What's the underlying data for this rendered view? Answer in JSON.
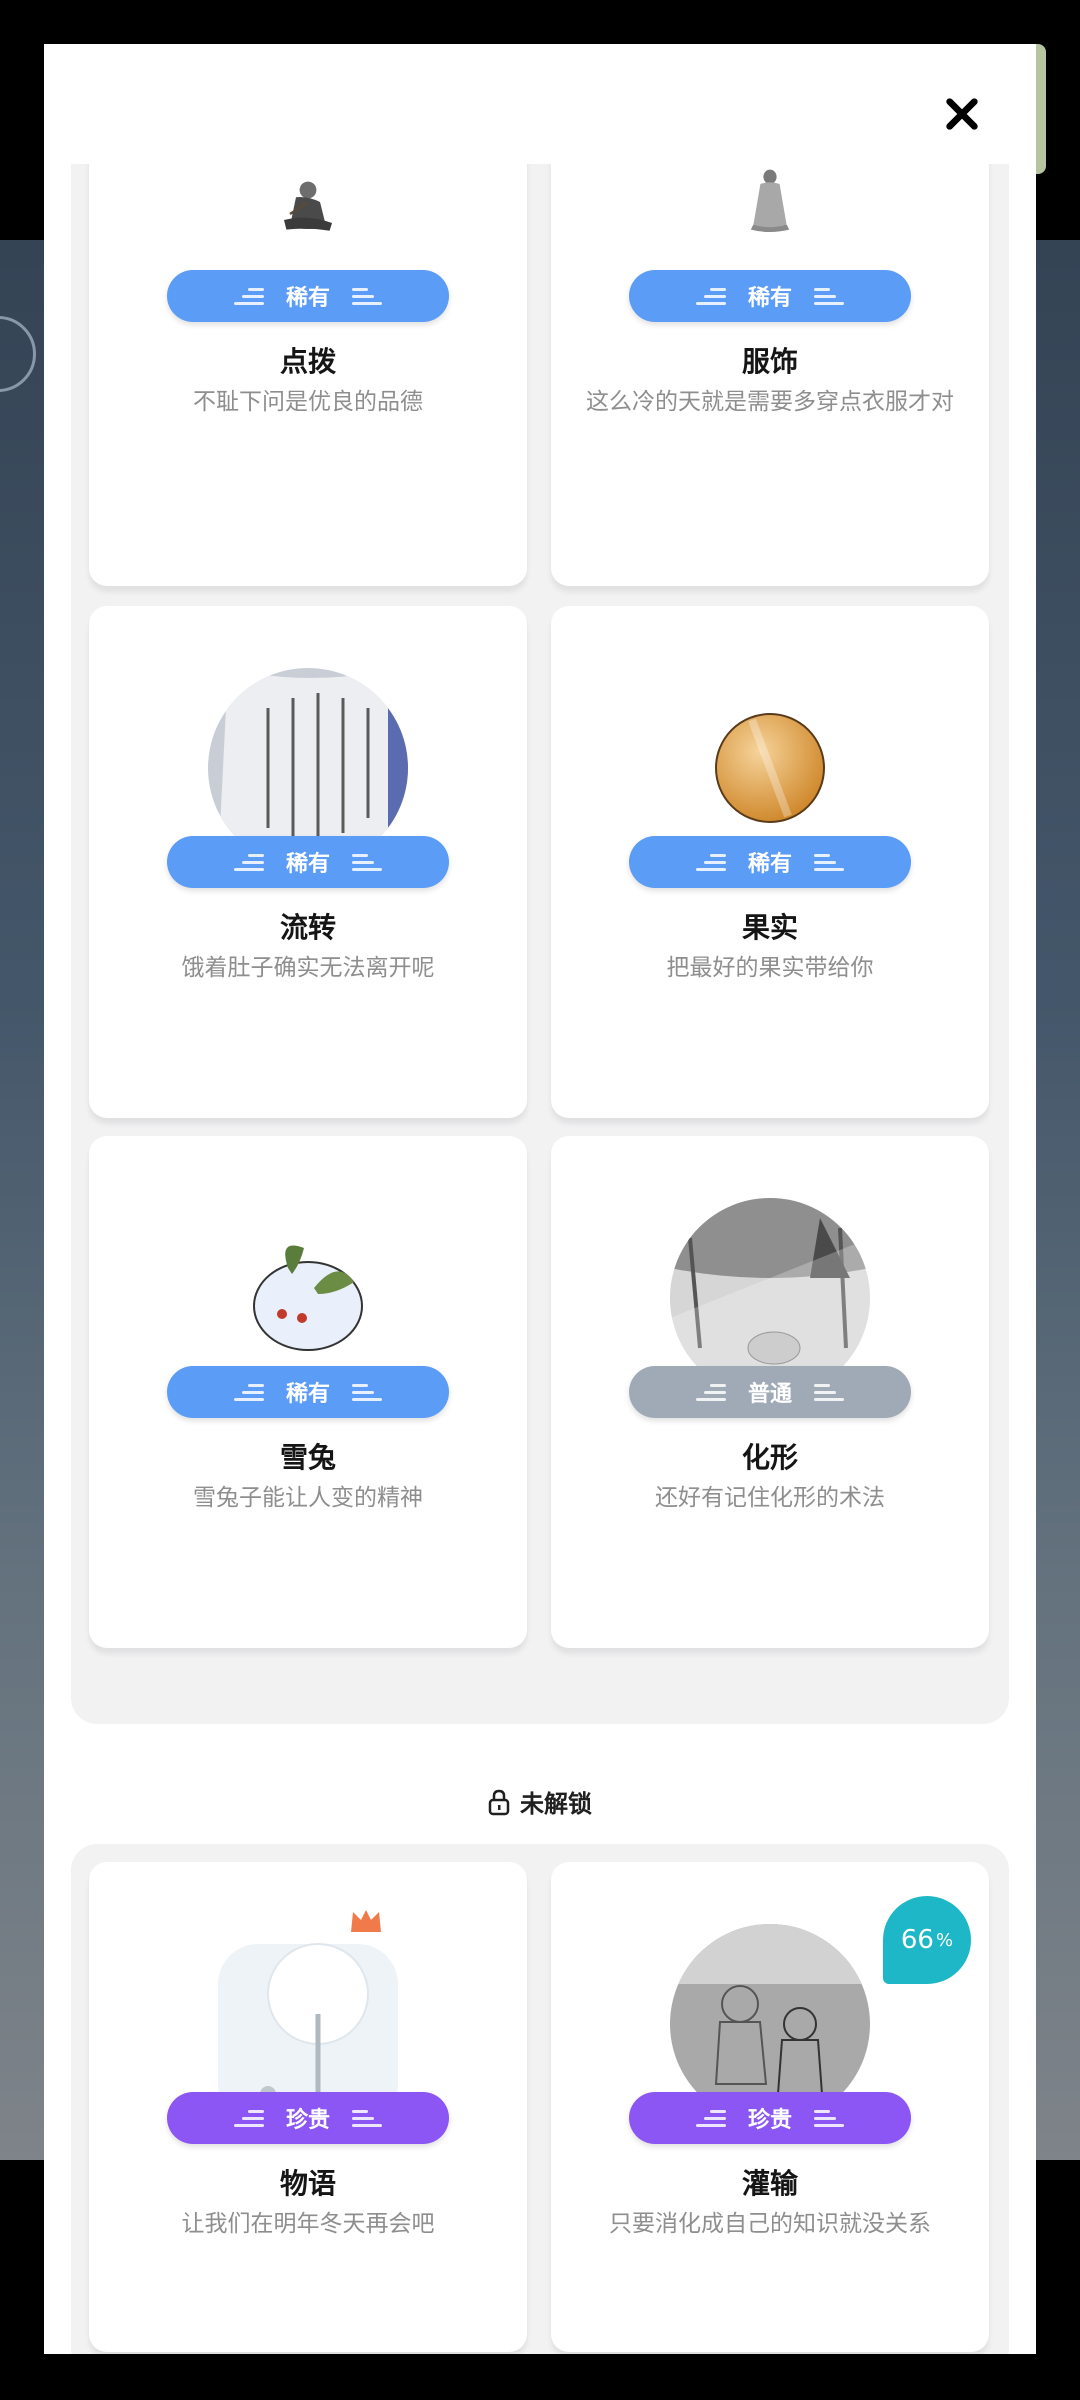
{
  "close_label": "×",
  "locked_section": {
    "label": "未解锁"
  },
  "unlocked_cards": [
    {
      "title": "点拨",
      "desc": "不耻下问是优良的品德",
      "rarity": "稀有",
      "rarity_type": "rare",
      "art": "seated-sage-figure"
    },
    {
      "title": "服饰",
      "desc": "这么冷的天就是需要多穿点衣服才对",
      "rarity": "稀有",
      "rarity_type": "rare",
      "art": "robed-figure-back"
    },
    {
      "title": "流转",
      "desc": "饿着肚子确实无法离开呢",
      "rarity": "稀有",
      "rarity_type": "rare",
      "art": "calligraphy-scroll"
    },
    {
      "title": "果实",
      "desc": "把最好的果实带给你",
      "rarity": "稀有",
      "rarity_type": "rare",
      "art": "orange-fruit"
    },
    {
      "title": "雪兔",
      "desc": "雪兔子能让人变的精神",
      "rarity": "稀有",
      "rarity_type": "rare",
      "art": "snow-rabbit"
    },
    {
      "title": "化形",
      "desc": "还好有记住化形的术法",
      "rarity": "普通",
      "rarity_type": "common",
      "art": "misty-forest-elephant"
    }
  ],
  "locked_cards": [
    {
      "title": "物语",
      "desc": "让我们在明年冬天再会吧",
      "rarity": "珍贵",
      "rarity_type": "precious",
      "art": "snowy-tree"
    },
    {
      "title": "灌输",
      "desc": "只要消化成自己的知识就没关系",
      "rarity": "珍贵",
      "rarity_type": "precious",
      "art": "sketched-children",
      "progress_value": "66",
      "progress_unit": "%"
    }
  ],
  "colors": {
    "rare": "#5b9cf6",
    "common": "#a0a9b6",
    "precious": "#8b56f3",
    "progress": "#1eb7c7"
  }
}
